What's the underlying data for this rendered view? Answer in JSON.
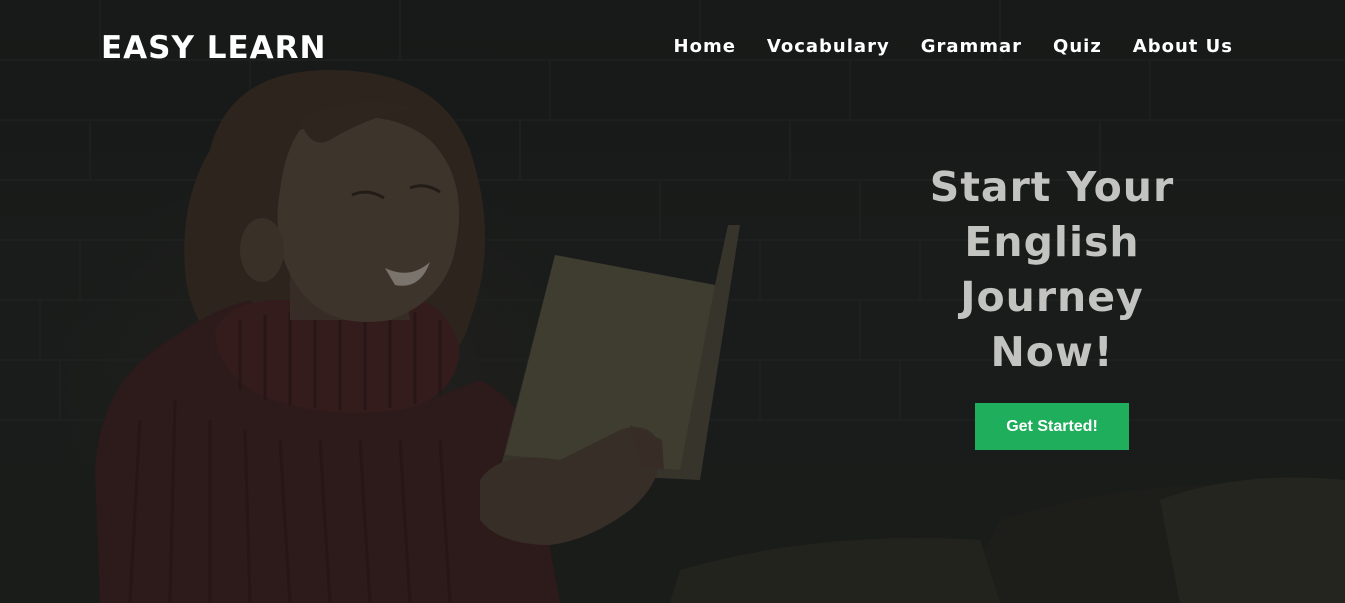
{
  "brand": {
    "name": "EASY LEARN"
  },
  "nav": {
    "items": [
      {
        "label": "Home"
      },
      {
        "label": "Vocabulary"
      },
      {
        "label": "Grammar"
      },
      {
        "label": "Quiz"
      },
      {
        "label": "About Us"
      }
    ]
  },
  "hero": {
    "headline": "Start Your English Journey Now!",
    "cta_label": "Get Started!",
    "image_description": "hero-image-woman-reading-book"
  },
  "colors": {
    "overlay": "#1b1d1c",
    "headline": "#c3c4c2",
    "cta": "#1fae5b",
    "nav_text": "#ffffff"
  }
}
